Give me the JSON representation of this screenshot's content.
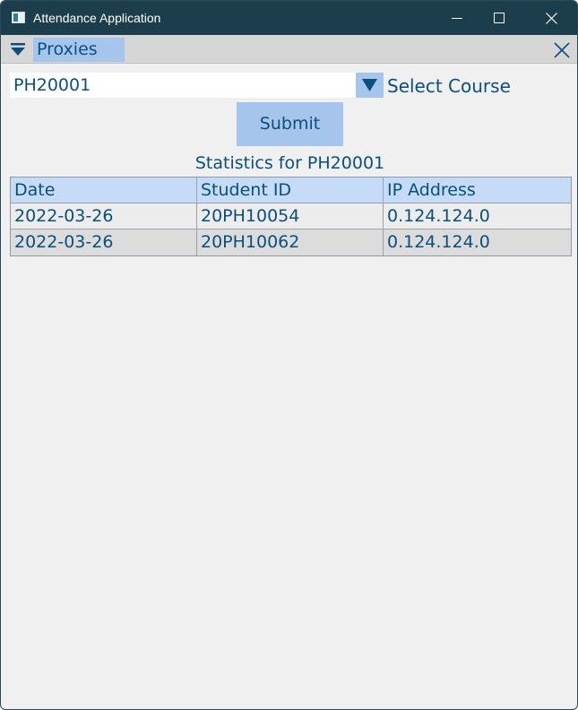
{
  "window": {
    "title": "Attendance Application"
  },
  "tabbar": {
    "active_tab": "Proxies",
    "icons": [
      "dropdown-arrow-icon",
      "close-icon"
    ]
  },
  "form": {
    "course_value": "PH20001",
    "select_label": "Select Course",
    "submit_label": "Submit"
  },
  "stats": {
    "title": "Statistics for PH20001",
    "columns": [
      "Date",
      "Student ID",
      "IP Address"
    ],
    "rows": [
      [
        "2022-03-26",
        "20PH10054",
        "0.124.124.0"
      ],
      [
        "2022-03-26",
        "20PH10062",
        "0.124.124.0"
      ]
    ]
  },
  "colors": {
    "titlebar": "#1c3d4b",
    "accent": "#a6c5ec",
    "text": "#0b4f7c",
    "table_header": "#c5dbf7"
  }
}
